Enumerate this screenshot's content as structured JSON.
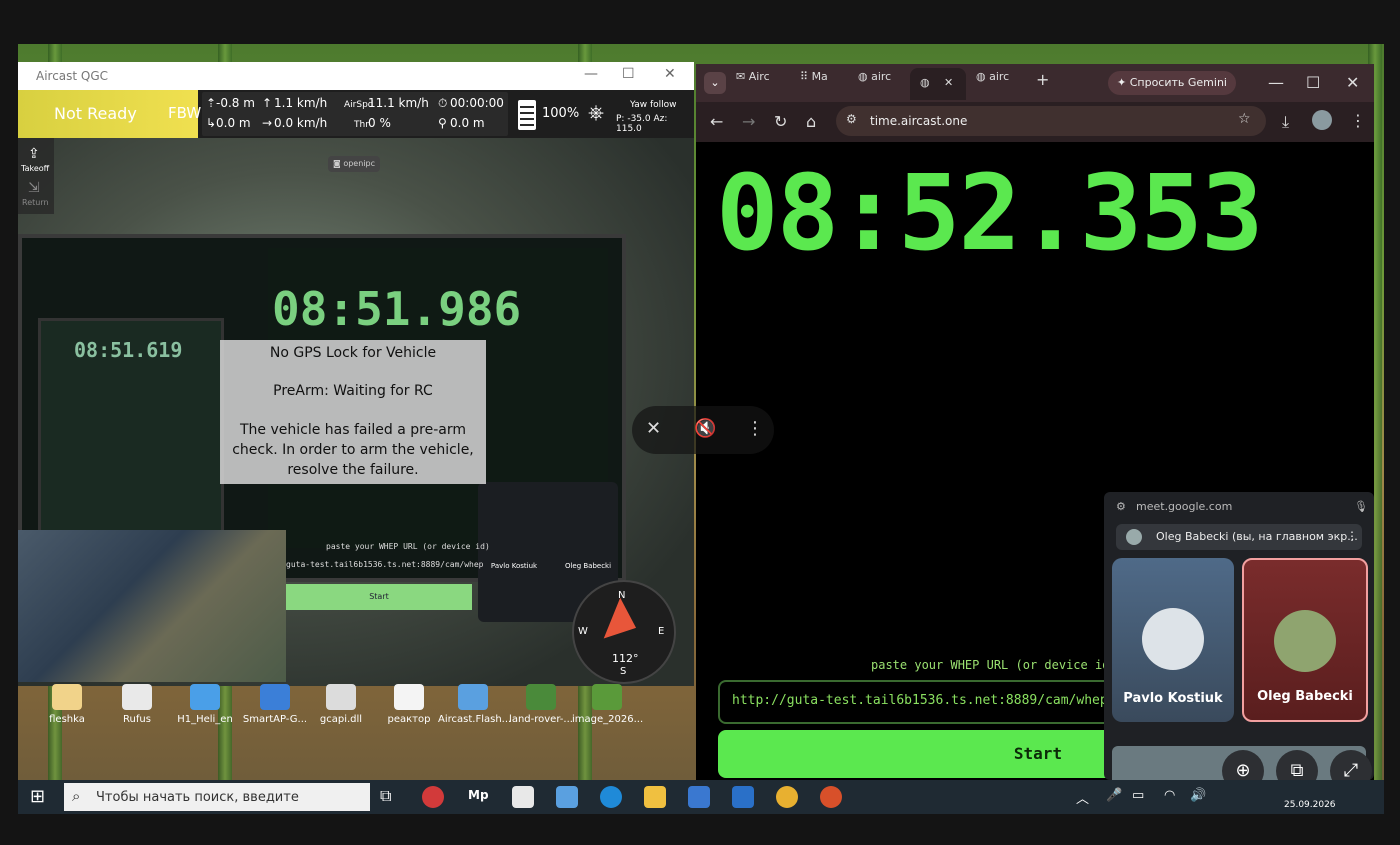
{
  "qgc": {
    "title": "Aircast QGC",
    "status": "Not Ready",
    "flight_mode": "FBW",
    "telemetry": {
      "alt_rel": "-0.8 m",
      "alt_amsl": "0.0 m",
      "vspeed": "1.1 km/h",
      "hspeed": "0.0 km/h",
      "airspeed_label": "AirSpd",
      "airspeed": "11.1 km/h",
      "throttle_label": "Thr",
      "throttle": "0 %",
      "flight_time": "00:00:00",
      "distance": "0.0 m",
      "battery": "100%",
      "gimbal_mode": "Yaw follow",
      "gimbal_pose": "P: -35.0 Az: 115.0"
    },
    "tools": {
      "takeoff": "Takeoff",
      "return": "Return"
    },
    "camera_badge": "openipc",
    "video": {
      "screen_time_main": "08:51.986",
      "screen_time_nested": "08:51.619",
      "whep_label": "paste your WHEP URL (or device id)",
      "whep_url": "guta-test.tail6b1536.ts.net:8889/cam/whep",
      "start": "Start",
      "participant_1": "Pavlo Kostiuk",
      "participant_2": "Oleg Babecki"
    },
    "messages": [
      "No GPS Lock for Vehicle",
      "PreArm: Waiting for RC",
      "The vehicle has failed a pre-arm check. In order to arm the vehicle, resolve the failure."
    ],
    "compass": {
      "n": "N",
      "e": "E",
      "s": "S",
      "w": "W",
      "heading": "112°"
    }
  },
  "desktop_icons": [
    {
      "label": "fleshka",
      "color": "#f1d38a"
    },
    {
      "label": "Rufus",
      "color": "#e9e9e9"
    },
    {
      "label": "H1_Heli_en",
      "color": "#4a9fe8"
    },
    {
      "label": "SmartAP-G...",
      "color": "#3b7fd8"
    },
    {
      "label": "gcapi.dll",
      "color": "#dcdcdc"
    },
    {
      "label": "реактор",
      "color": "#f4f4f4"
    },
    {
      "label": "Aircast.Flash...",
      "color": "#5aa0e0"
    },
    {
      "label": "land-rover-...",
      "color": "#4a8a3a"
    },
    {
      "label": "image_2026...",
      "color": "#5a9a3a"
    }
  ],
  "chrome": {
    "tabs": [
      "Airc",
      "Ma",
      "airc",
      "",
      "airc"
    ],
    "gemini": "Спросить Gemini",
    "url": "time.aircast.one",
    "time": "08:52.353",
    "whep_label": "paste your WHEP URL (or device id)",
    "whep_url": "http://guta-test.tail6b1536.ts.net:8889/cam/whep",
    "start": "Start"
  },
  "meet": {
    "url": "meet.google.com",
    "presenter": "Oleg Babecki (вы, на главном экр...",
    "participants": [
      "Pavlo Kostiuk",
      "Oleg Babecki"
    ]
  },
  "taskbar": {
    "search_placeholder": "Чтобы начать поиск, введите",
    "date": "25.09.2026",
    "mp_label": "Mp"
  },
  "colors": {
    "timer_green": "#5be84f",
    "qgc_status_yellow": "#e6dd48",
    "meet_active_border": "#f2a0a0"
  }
}
